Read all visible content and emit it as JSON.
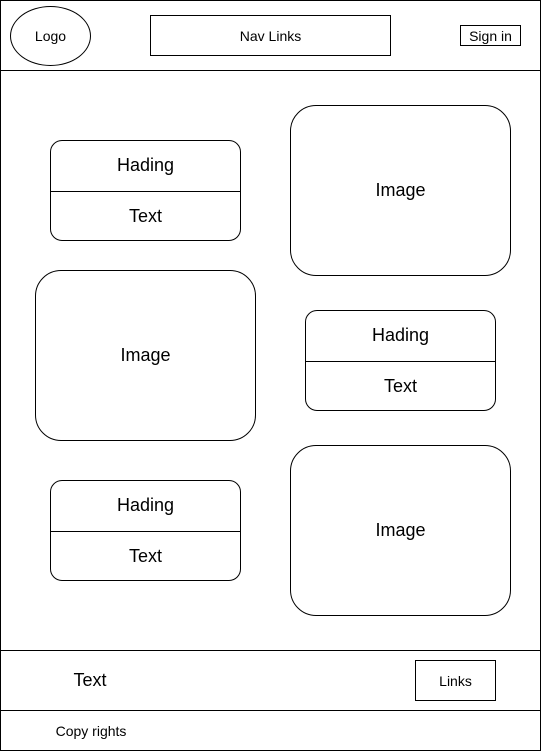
{
  "header": {
    "logo": "Logo",
    "nav_links": "Nav Links",
    "sign_in": "Sign in"
  },
  "main": {
    "cards": [
      {
        "heading": "Hading",
        "text": "Text"
      },
      {
        "heading": "Hading",
        "text": "Text"
      },
      {
        "heading": "Hading",
        "text": "Text"
      }
    ],
    "images": [
      {
        "label": "Image"
      },
      {
        "label": "Image"
      },
      {
        "label": "Image"
      }
    ]
  },
  "footer": {
    "text": "Text",
    "links": "Links",
    "copyright": "Copy rights"
  }
}
